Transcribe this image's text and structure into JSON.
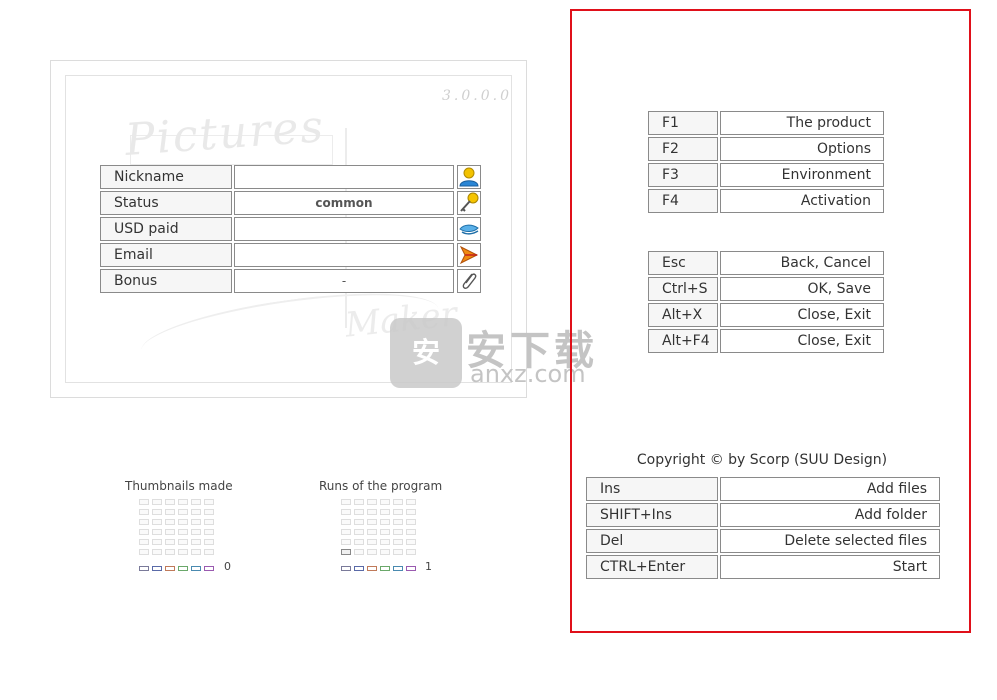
{
  "info_panel": {
    "version": "3.0.0.0",
    "deco_title": "Pictures",
    "deco_maker": "Maker",
    "rows": [
      {
        "label": "Nickname",
        "value": "",
        "icon": "user-icon"
      },
      {
        "label": "Status",
        "value": "common",
        "icon": "key-icon"
      },
      {
        "label": "USD paid",
        "value": "",
        "icon": "money-icon"
      },
      {
        "label": "Email",
        "value": "",
        "icon": "email-icon"
      },
      {
        "label": "Bonus",
        "value": "-",
        "icon": "paperclip-icon"
      }
    ]
  },
  "stats": [
    {
      "title": "Thumbnails made",
      "count": "0",
      "filled": 0
    },
    {
      "title": "Runs of the program",
      "count": "1",
      "filled": 1
    }
  ],
  "legend_colors": [
    "#7a7a9a",
    "#5a6aa8",
    "#c07a5a",
    "#6aa86a",
    "#4a8ab0",
    "#9a5ab0"
  ],
  "watermark": {
    "cn": "安下载",
    "en": "anxz.com",
    "glyph": "安"
  },
  "hotkeys": {
    "group1": [
      {
        "key": "F1",
        "action": "The product"
      },
      {
        "key": "F2",
        "action": "Options"
      },
      {
        "key": "F3",
        "action": "Environment"
      },
      {
        "key": "F4",
        "action": "Activation"
      }
    ],
    "group2": [
      {
        "key": "Esc",
        "action": "Back, Cancel"
      },
      {
        "key": "Ctrl+S",
        "action": "OK, Save"
      },
      {
        "key": "Alt+X",
        "action": "Close, Exit"
      },
      {
        "key": "Alt+F4",
        "action": "Close, Exit"
      }
    ],
    "copyright": "Copyright © by Scorp (SUU Design)",
    "group3": [
      {
        "key": "Ins",
        "action": "Add files"
      },
      {
        "key": "SHIFT+Ins",
        "action": "Add folder"
      },
      {
        "key": "Del",
        "action": "Delete selected files"
      },
      {
        "key": "CTRL+Enter",
        "action": "Start"
      }
    ]
  },
  "colors": {
    "frame_red": "#e0101a"
  }
}
